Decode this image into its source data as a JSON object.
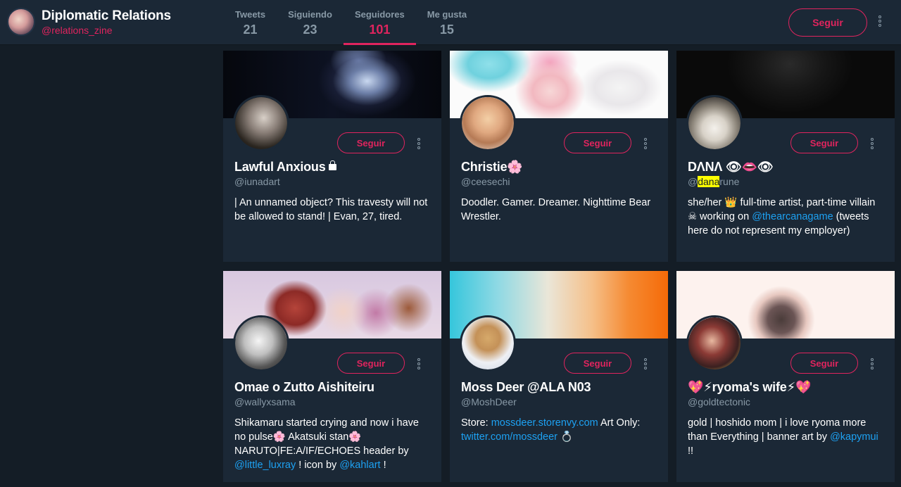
{
  "profile": {
    "name": "Diplomatic Relations",
    "handle": "@relations_zine"
  },
  "nav": [
    {
      "label": "Tweets",
      "value": "21",
      "active": false
    },
    {
      "label": "Siguiendo",
      "value": "23",
      "active": false
    },
    {
      "label": "Seguidores",
      "value": "101",
      "active": true
    },
    {
      "label": "Me gusta",
      "value": "15",
      "active": false
    }
  ],
  "follow_label": "Seguir",
  "colors": {
    "accent": "#e0245e",
    "background": "#141d26",
    "card": "#1b2836",
    "link": "#1da1f2",
    "muted": "#8899a6"
  },
  "cards": [
    {
      "name": "Lawful Anxious",
      "handle": "@iunadart",
      "bio": "| An unnamed object? This travesty will not be allowed to stand! | Evan, 27, tired.",
      "icons": [
        "lock-icon"
      ]
    },
    {
      "name": "Christie",
      "name_emoji": "🌸",
      "handle": "@ceesechi",
      "bio": "Doodler. Gamer. Dreamer. Nighttime Bear Wrestler."
    },
    {
      "name": "DΛNΛ",
      "name_emoji": "👁👄👁",
      "handle_prefix": "@",
      "handle_highlight": "dana",
      "handle_suffix": "rune",
      "bio_1": "she/her",
      "bio_emoji_1": "👑",
      "bio_2": "full-time artist, part-time villain",
      "bio_emoji_2": "☠",
      "bio_3": "working on",
      "bio_link": "@thearcanagame",
      "bio_4": "(tweets here do not represent my employer)"
    },
    {
      "name": "Omae o Zutto Aishiteiru",
      "handle": "@wallyxsama",
      "bio_1": "Shikamaru started crying and now i have no pulse",
      "bio_emoji_1": "🌸",
      "bio_2": "Akatsuki stan",
      "bio_emoji_2": "🌸",
      "bio_3": "NARUTO|FE:A/IF/ECHOES header by",
      "bio_link_1": "@little_luxray",
      "bio_4": "! icon by",
      "bio_link_2": "@kahlart",
      "bio_5": "!"
    },
    {
      "name": "Moss Deer @ALA N03",
      "handle": "@MoshDeer",
      "bio_1": "Store:",
      "bio_link_1": "mossdeer.storenvy.com",
      "bio_2": "Art Only:",
      "bio_link_2": "twitter.com/mossdeer",
      "bio_emoji": "💍"
    },
    {
      "name_emoji_1": "💖⚡",
      "name": "ryoma's wife",
      "name_emoji_2": "⚡💖",
      "handle": "@goldtectonic",
      "bio_1": "gold | hoshido mom | i love ryoma more than Everything | banner art by",
      "bio_link": "@kapymui",
      "bio_2": "!!"
    }
  ]
}
